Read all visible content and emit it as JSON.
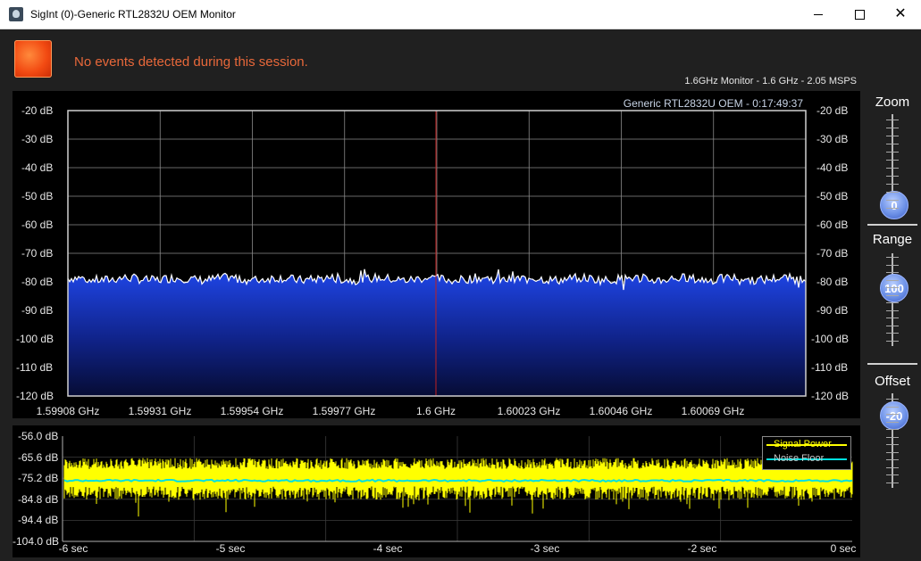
{
  "window": {
    "title": "SigInt (0)-Generic RTL2832U OEM Monitor",
    "icon": "app-icon",
    "minimize_icon": "minimize-icon",
    "maximize_icon": "maximize-icon",
    "close_icon": "close-icon"
  },
  "status": {
    "message": "No events detected during this session.",
    "indicator_color": "#f24a12",
    "message_color": "#e8683a"
  },
  "monitor_info": "1.6GHz Monitor - 1.6 GHz - 2.05 MSPS",
  "spectrum": {
    "device_label": "Generic RTL2832U OEM - 0:17:49:37",
    "db_labels": [
      "-20 dB",
      "-30 dB",
      "-40 dB",
      "-50 dB",
      "-60 dB",
      "-70 dB",
      "-80 dB",
      "-90 dB",
      "-100 dB",
      "-110 dB",
      "-120 dB"
    ],
    "freq_labels": [
      "1.59908 GHz",
      "1.59931 GHz",
      "1.59954 GHz",
      "1.59977 GHz",
      "1.6 GHz",
      "1.60023 GHz",
      "1.60046 GHz",
      "1.60069 GHz"
    ],
    "noise_level_db": -79,
    "fill_color": "#1a3ad0",
    "trace_color": "#ffffff",
    "center_marker_color": "#c02020"
  },
  "power": {
    "db_labels": [
      "-56.0 dB",
      "-65.6 dB",
      "-75.2 dB",
      "-84.8 dB",
      "-94.4 dB",
      "-104.0 dB"
    ],
    "time_labels": [
      "-6 sec",
      "-5 sec",
      "-4 sec",
      "-3 sec",
      "-2 sec",
      "-1 sec",
      "0 sec"
    ],
    "legend": {
      "signal_label": "Signal Power",
      "noise_label": "Noise Floor",
      "signal_color": "#ffff00",
      "noise_color": "#00e0e0"
    }
  },
  "controls": {
    "zoom": {
      "label": "Zoom",
      "value": "0"
    },
    "range": {
      "label": "Range",
      "value": "100"
    },
    "offset": {
      "label": "Offset",
      "value": "-20"
    }
  }
}
